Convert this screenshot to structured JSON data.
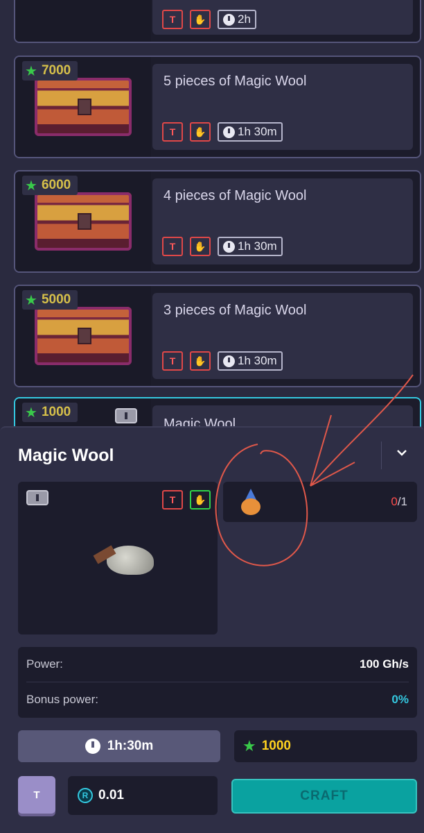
{
  "list": {
    "items": [
      {
        "title": "",
        "price": "",
        "time": "2h"
      },
      {
        "title": "5 pieces of Magic Wool",
        "price": "7000",
        "time": "1h 30m"
      },
      {
        "title": "4 pieces of Magic Wool",
        "price": "6000",
        "time": "1h 30m"
      },
      {
        "title": "3 pieces of Magic Wool",
        "price": "5000",
        "time": "1h 30m"
      },
      {
        "title": "Magic Wool",
        "price": "1000",
        "time": ""
      }
    ],
    "badge_tool": "T",
    "badge_glove": "✋"
  },
  "sheet": {
    "title": "Magic Wool",
    "part": {
      "have": "0",
      "need": "/1"
    },
    "stats": [
      {
        "label": "Power:",
        "value": "100 Gh/s"
      },
      {
        "label": "Bonus power:",
        "value": "0%"
      }
    ],
    "time": "1h:30m",
    "price": "1000",
    "tool_label": "T",
    "coin_symbol": "R",
    "coin_value": "0.01",
    "craft_label": "CRAFT"
  },
  "colors": {
    "accent": "#0aa2a0",
    "price_gold": "#ffd21f",
    "warning_red": "#ff4d4d",
    "selected_border": "#34c8e0"
  },
  "icons": [
    "star-icon",
    "clock-icon",
    "tool-icon",
    "glove-icon",
    "chevron-down-icon",
    "coin-icon"
  ]
}
